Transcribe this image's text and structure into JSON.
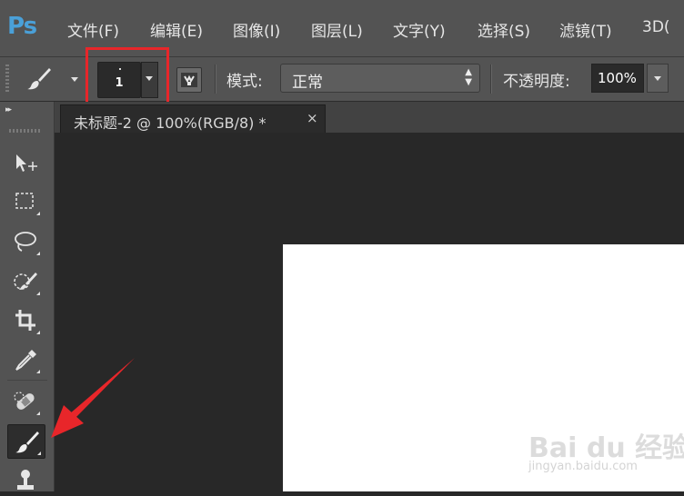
{
  "app": {
    "logo": "Ps"
  },
  "menu": {
    "items": [
      "文件(F)",
      "编辑(E)",
      "图像(I)",
      "图层(L)",
      "文字(Y)",
      "选择(S)",
      "滤镜(T)",
      "3D("
    ]
  },
  "options": {
    "brush_size": "1",
    "mode_label": "模式:",
    "mode_value": "正常",
    "opacity_label": "不透明度:",
    "opacity_value": "100%"
  },
  "document": {
    "tab_title": "未标题-2 @ 100%(RGB/8) *",
    "close_glyph": "×"
  },
  "toolbar": {
    "collapse_glyph": "▸▸",
    "tools": [
      "move-tool",
      "marquee-tool",
      "lasso-tool",
      "quick-selection-tool",
      "crop-tool",
      "eyedropper-tool",
      "healing-brush-tool",
      "brush-tool",
      "clone-stamp-tool"
    ],
    "active_tool": "brush-tool"
  },
  "watermark": {
    "logo": "Bai du 经验",
    "url": "jingyan.baidu.com"
  },
  "colors": {
    "highlight": "#e8262a",
    "ps_blue": "#4aa0d8",
    "panel": "#535353",
    "workspace": "#282828"
  }
}
